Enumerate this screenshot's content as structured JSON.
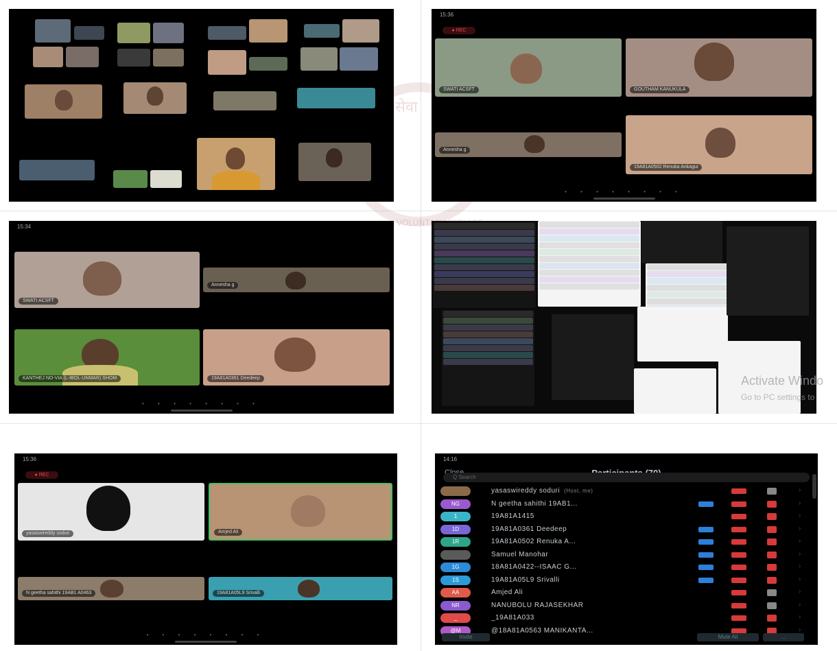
{
  "watermark": {
    "line1": "Activate Windo",
    "line2": "Go to PC settings to"
  },
  "rec_label": "● REC",
  "panels": {
    "p6_title": "Participants (70)",
    "p6_close": "Close",
    "p6_search": "Q Search",
    "p6_rows": [
      {
        "avatar": "",
        "avatar_color": "#8a6a48",
        "name": "yasaswireddy soduri",
        "sub": "(Host, me)",
        "video": "#00000000",
        "hand": "#888"
      },
      {
        "avatar": "NG",
        "avatar_color": "#9b59d0",
        "name": "N geetha sahithi 19AB1...",
        "sub": "",
        "video": "#2d7fd8",
        "hand": "#d63a3a"
      },
      {
        "avatar": "1",
        "avatar_color": "#3cb4c8",
        "name": "19A81A1415",
        "sub": "",
        "video": "#00000000",
        "hand": "#d63a3a"
      },
      {
        "avatar": "1D",
        "avatar_color": "#7a67d6",
        "name": "19A81A0361 Deedeep",
        "sub": "",
        "video": "#2d7fd8",
        "hand": "#d63a3a"
      },
      {
        "avatar": "1R",
        "avatar_color": "#2ea58a",
        "name": "19A81A0502 Renuka A...",
        "sub": "",
        "video": "#2d7fd8",
        "hand": "#d63a3a"
      },
      {
        "avatar": "",
        "avatar_color": "#5a5a5a",
        "name": "Samuel Manohar",
        "sub": "",
        "video": "#2d7fd8",
        "hand": "#d63a3a"
      },
      {
        "avatar": "1G",
        "avatar_color": "#2d8ad8",
        "name": "18A81A0422--ISAAC G...",
        "sub": "",
        "video": "#2d7fd8",
        "hand": "#d63a3a"
      },
      {
        "avatar": "1S",
        "avatar_color": "#2d9ad8",
        "name": "19A81A05L9 Srivalli",
        "sub": "",
        "video": "#2d7fd8",
        "hand": "#d63a3a"
      },
      {
        "avatar": "AA",
        "avatar_color": "#e05a4a",
        "name": "Amjed Ali",
        "sub": "",
        "video": "#00000000",
        "hand": "#888"
      },
      {
        "avatar": "NR",
        "avatar_color": "#8a5ad0",
        "name": "NANUBOLU RAJASEKHAR",
        "sub": "",
        "video": "#00000000",
        "hand": "#888"
      },
      {
        "avatar": "_",
        "avatar_color": "#e04a4a",
        "name": "_19A81A033",
        "sub": "",
        "video": "#00000000",
        "hand": "#d63a3a"
      },
      {
        "avatar": "@M",
        "avatar_color": "#b05ac8",
        "name": "@18A81A0563 MANIKANTA...",
        "sub": "",
        "video": "#00000000",
        "hand": "#d63a3a"
      }
    ],
    "p6_invite": "Invite",
    "p6_muteall": "Mute All",
    "p6_more": "..."
  },
  "tiles": {
    "p2": [
      "SWATI ACSFT",
      "GOUTHAM KANUKULA",
      "Annesha g",
      "19A81A0502 Renuka Ankagui"
    ],
    "p3": [
      "SWATI ACSFT",
      "Annesha g",
      "KANTHEJ NO-VIA (L-IBOL-UNMAR) SHOM",
      "19A81A0361 Deedeep"
    ],
    "p5": [
      "yasaswireddy soduri",
      "Amjed Ali",
      "N geetha sahithi 19AB1 A0463",
      "19A81A05L9 Srivalli"
    ]
  }
}
